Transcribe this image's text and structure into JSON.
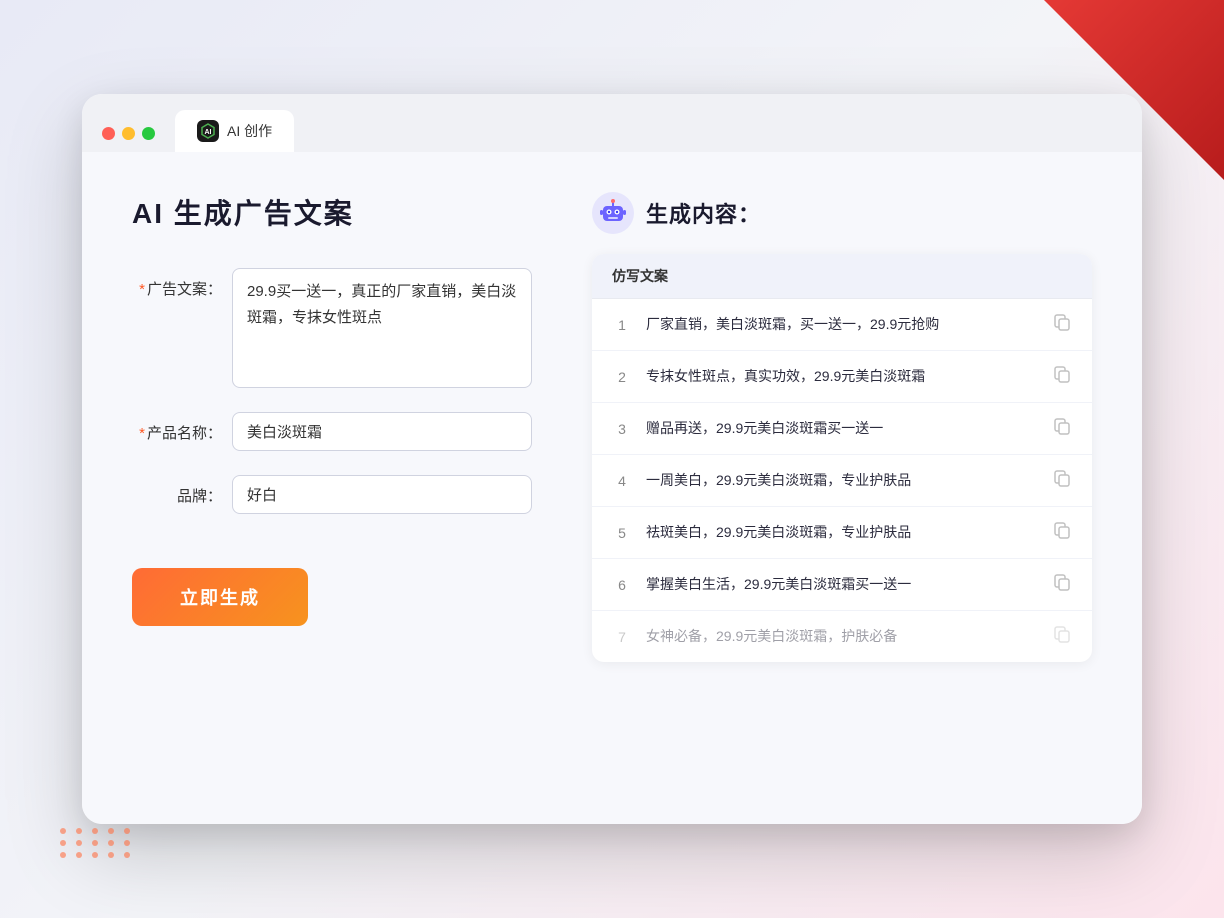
{
  "browser": {
    "tab_label": "AI 创作"
  },
  "page": {
    "title": "AI 生成广告文案"
  },
  "form": {
    "ad_copy_label": "广告文案：",
    "ad_copy_required": "*",
    "ad_copy_value": "29.9买一送一，真正的厂家直销，美白淡斑霜，专抹女性斑点",
    "product_name_label": "产品名称：",
    "product_name_required": "*",
    "product_name_value": "美白淡斑霜",
    "brand_label": "品牌：",
    "brand_value": "好白",
    "submit_label": "立即生成"
  },
  "result": {
    "header_label": "生成内容：",
    "column_header": "仿写文案",
    "rows": [
      {
        "num": "1",
        "text": "厂家直销，美白淡斑霜，买一送一，29.9元抢购",
        "faded": false
      },
      {
        "num": "2",
        "text": "专抹女性斑点，真实功效，29.9元美白淡斑霜",
        "faded": false
      },
      {
        "num": "3",
        "text": "赠品再送，29.9元美白淡斑霜买一送一",
        "faded": false
      },
      {
        "num": "4",
        "text": "一周美白，29.9元美白淡斑霜，专业护肤品",
        "faded": false
      },
      {
        "num": "5",
        "text": "祛斑美白，29.9元美白淡斑霜，专业护肤品",
        "faded": false
      },
      {
        "num": "6",
        "text": "掌握美白生活，29.9元美白淡斑霜买一送一",
        "faded": false
      },
      {
        "num": "7",
        "text": "女神必备，29.9元美白淡斑霜，护肤必备",
        "faded": true
      }
    ]
  },
  "colors": {
    "accent": "#ff6b35",
    "primary": "#5b8dee"
  }
}
